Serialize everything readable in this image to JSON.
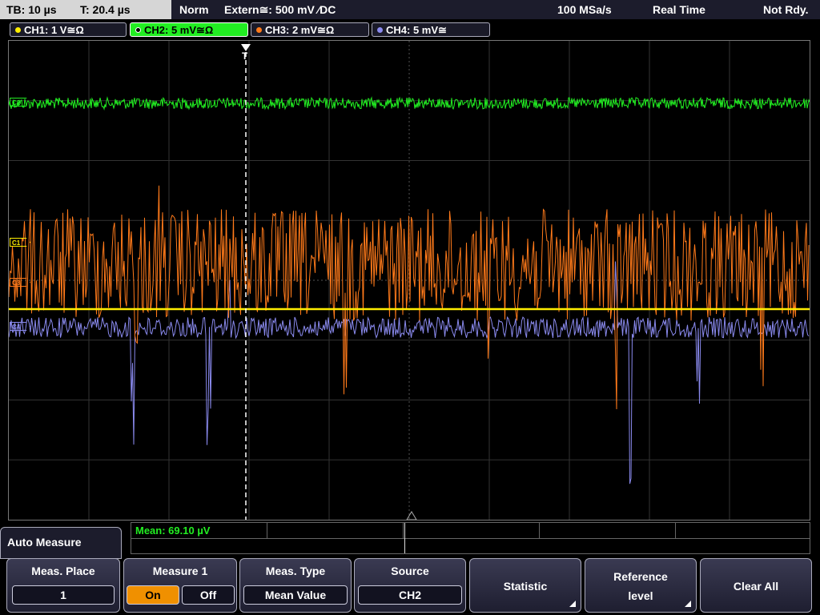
{
  "topbar": {
    "timebase": "TB: 10 µs",
    "trigger_time": "T: 20.4 µs",
    "mode": "Norm",
    "trigger": "Extern≅: 500 mV ⁄DC",
    "sample_rate": "100 MSa/s",
    "acq_mode": "Real Time",
    "status": "Not Rdy."
  },
  "channels": [
    {
      "label": "CH1: 1 V≅Ω",
      "color": "#ffee00",
      "marker": "C1"
    },
    {
      "label": "CH2: 5 mV≅Ω",
      "color": "#22ee22",
      "marker": "C2"
    },
    {
      "label": "CH3: 2 mV≅Ω",
      "color": "#ff7a1a",
      "marker": "C3"
    },
    {
      "label": "CH4: 5 mV≅",
      "color": "#8a8aee",
      "marker": "C4"
    }
  ],
  "trigger_marker": "T",
  "result": {
    "mean": "Mean: 69.10 µV"
  },
  "menu": {
    "title": "Auto Measure",
    "meas_place": {
      "label": "Meas. Place",
      "value": "1"
    },
    "measure1": {
      "label": "Measure 1",
      "on": "On",
      "off": "Off"
    },
    "meas_type": {
      "label": "Meas. Type",
      "value": "Mean Value"
    },
    "source": {
      "label": "Source",
      "value": "CH2"
    },
    "statistic": "Statistic",
    "reference_line1": "Reference",
    "reference_line2": "level",
    "clear_all": "Clear All"
  }
}
